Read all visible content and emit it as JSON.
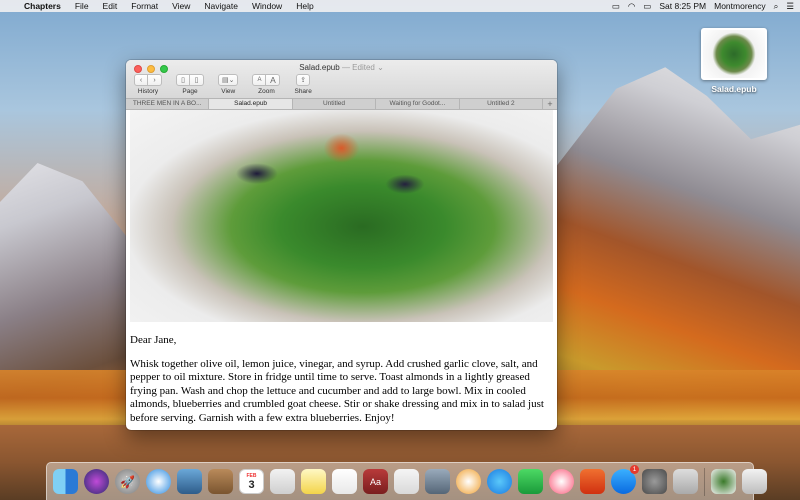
{
  "menubar": {
    "app_name": "Chapters",
    "menus": [
      "File",
      "Edit",
      "Format",
      "View",
      "Navigate",
      "Window",
      "Help"
    ],
    "clock": "Sat 8:25 PM",
    "user": "Montmorency"
  },
  "desktop": {
    "file_label": "Salad.epub"
  },
  "window": {
    "title": "Salad.epub",
    "edited": "— Edited ⌄",
    "toolbar": {
      "history_label": "History",
      "page_label": "Page",
      "view_label": "View",
      "zoom_label": "Zoom",
      "share_label": "Share",
      "zoom_small": "A",
      "zoom_large": "A"
    },
    "tabs": [
      {
        "label": "THREE MEN IN A BO..."
      },
      {
        "label": "Salad.epub"
      },
      {
        "label": "Untitled"
      },
      {
        "label": "Waiting for Godot..."
      },
      {
        "label": "Untitled 2"
      }
    ],
    "active_tab": 1,
    "letter": {
      "greeting": "Dear Jane,",
      "body": "Whisk together olive oil, lemon juice, vinegar, and syrup. Add crushed garlic clove, salt, and pepper to oil mixture. Store in fridge until time to serve. Toast almonds in a lightly greased frying pan. Wash and chop the lettuce and cucumber and add to large bowl. Mix in cooled almonds, blueberries and crumbled goat cheese. Stir or shake dressing and mix in to salad just before serving. Garnish with a few extra blueberries. Enjoy!"
    }
  },
  "dock": {
    "calendar_month": "FEB",
    "calendar_day": "3",
    "app_store_badge": "1",
    "dictionary_glyph": "Aa"
  }
}
